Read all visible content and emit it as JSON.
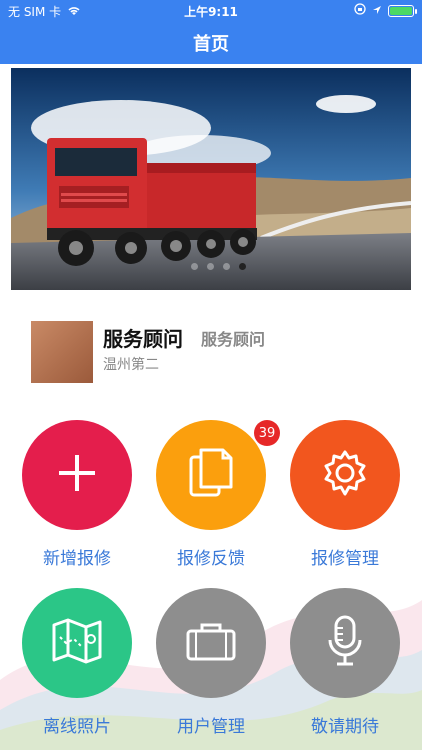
{
  "status_bar": {
    "carrier": "无 SIM 卡",
    "time": "上午9:11"
  },
  "nav": {
    "title": "首页"
  },
  "banner": {
    "slide_count": 4,
    "active_index": 3
  },
  "profile": {
    "name": "服务顾问",
    "role": "服务顾问",
    "org": "温州第二"
  },
  "actions": [
    {
      "label": "新增报修",
      "color": "#e41e4c",
      "icon": "plus-icon"
    },
    {
      "label": "报修反馈",
      "color": "#fb9f0d",
      "icon": "documents-icon",
      "badge": "39"
    },
    {
      "label": "报修管理",
      "color": "#f2561e",
      "icon": "gear-icon"
    },
    {
      "label": "离线照片",
      "color": "#2bc687",
      "icon": "map-icon"
    },
    {
      "label": "用户管理",
      "color": "#8e8e8e",
      "icon": "briefcase-icon"
    },
    {
      "label": "敬请期待",
      "color": "#8e8e8e",
      "icon": "microphone-icon"
    }
  ]
}
